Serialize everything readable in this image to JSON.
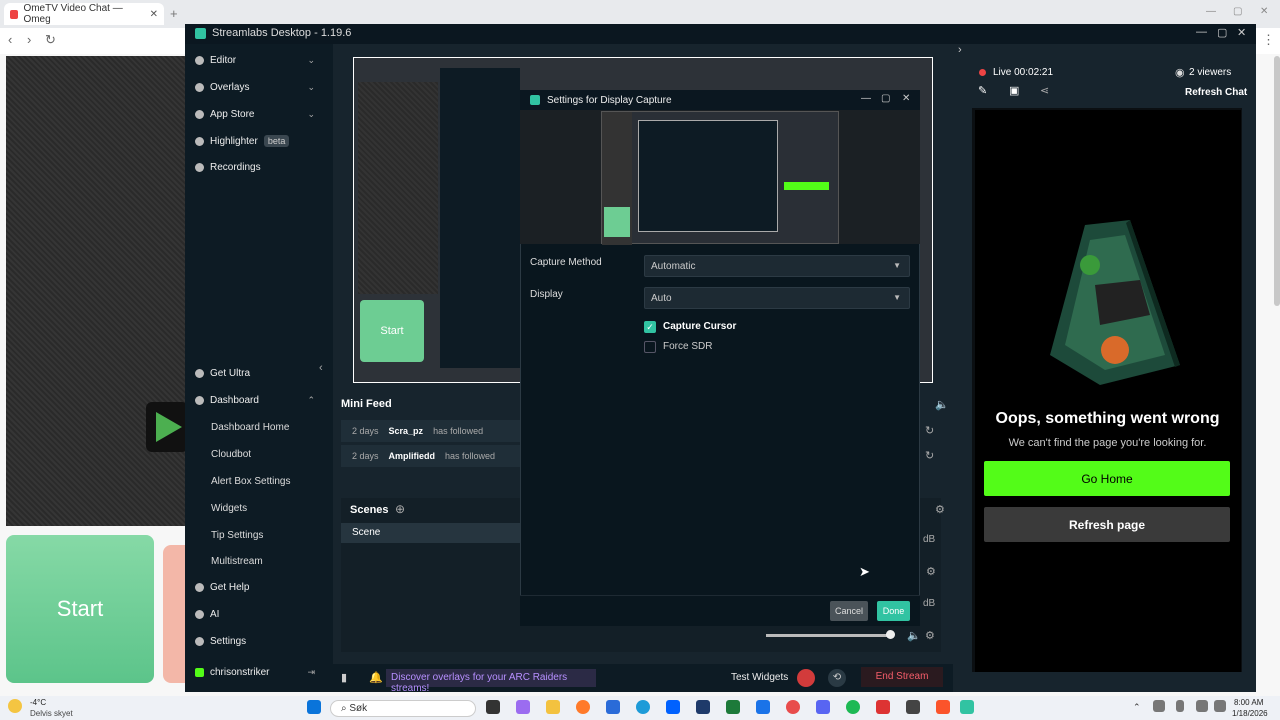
{
  "browser": {
    "tab_title": "OmeTV Video Chat — Omeg",
    "new_tab": "+",
    "close": "✕"
  },
  "omegle": {
    "start": "Start"
  },
  "streamlabs": {
    "title": "Streamlabs Desktop - 1.19.6",
    "sidebar": [
      {
        "label": "Editor"
      },
      {
        "label": "Overlays"
      },
      {
        "label": "App Store"
      },
      {
        "label": "Highlighter",
        "badge": "beta"
      },
      {
        "label": "Recordings"
      }
    ],
    "sidebar_lower": {
      "get_ultra": "Get Ultra",
      "dashboard": "Dashboard",
      "dashboard_home": "Dashboard Home",
      "cloudbot": "Cloudbot",
      "alert_box": "Alert Box Settings",
      "widgets": "Widgets",
      "tip_settings": "Tip Settings",
      "multistream": "Multistream",
      "get_help": "Get Help",
      "ai": "AI",
      "settings": "Settings",
      "user": "chrisonstriker"
    },
    "preview_start": "Start",
    "mini_feed": {
      "title": "Mini Feed",
      "rows": [
        {
          "time": "2 days",
          "user": "Scra_pz",
          "action": "has followed"
        },
        {
          "time": "2 days",
          "user": "Amplifiedd",
          "action": "has followed"
        }
      ]
    },
    "scenes": {
      "title": "Scenes",
      "header": "Scene"
    },
    "statusbar": {
      "discover": "Discover overlays for your ARC Raiders streams!",
      "test_widgets": "Test Widgets",
      "end_stream": "End Stream",
      "db1": "dB",
      "db2": "dB"
    }
  },
  "chat": {
    "live": "Live 00:02:21",
    "viewers": "2 viewers",
    "refresh_chat": "Refresh Chat",
    "oops": "Oops, something went wrong",
    "not_found": "We can't find the page you're looking for.",
    "go_home": "Go Home",
    "refresh_page": "Refresh page",
    "colors": {
      "accent": "#53fc18"
    }
  },
  "dialog": {
    "title": "Settings for Display Capture",
    "capture_method_label": "Capture Method",
    "capture_method_value": "Automatic",
    "display_label": "Display",
    "display_value": "Auto",
    "capture_cursor": "Capture Cursor",
    "force_sdr": "Force SDR",
    "cancel": "Cancel",
    "done": "Done"
  },
  "taskbar": {
    "weather_temp": "-4°C",
    "weather_desc": "Delvis skyet",
    "search": "Søk",
    "time": "8:00 AM",
    "date": "1/18/2026"
  }
}
